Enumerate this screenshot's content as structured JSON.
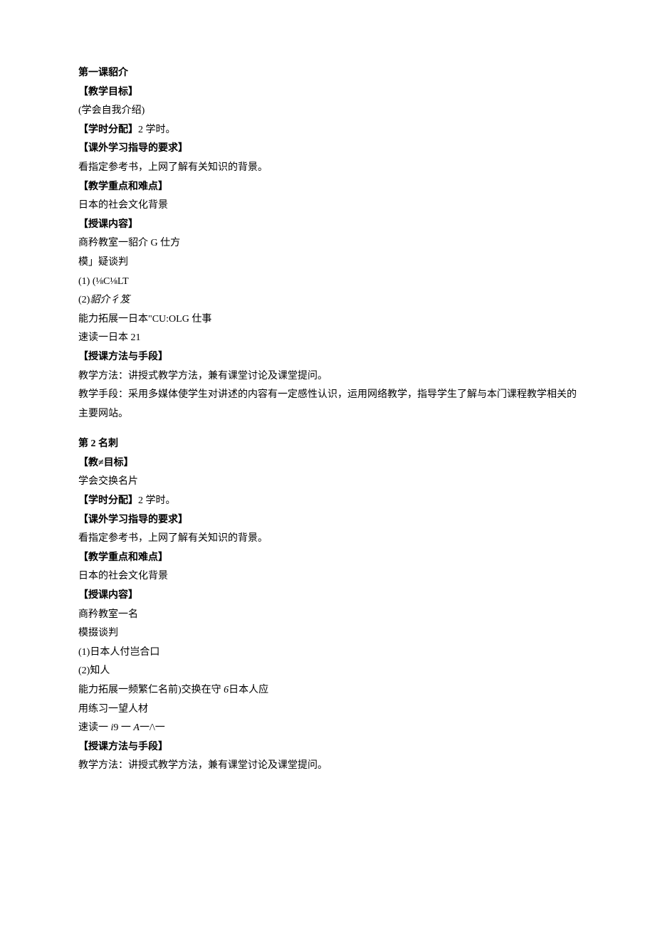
{
  "lesson1": {
    "title": "第一课貂介",
    "goal_label": "【教学目标】",
    "goal_text": "(学会自我介绍)",
    "hours_label": "【学时分配】",
    "hours_text": "2 学时。",
    "extra_label": "【课外学习指导的要求】",
    "extra_text": "看指定参考书，上网了解有关知识的背景。",
    "focus_label": "【教学重点和难点】",
    "focus_text": "日本的社会文化背景",
    "content_label": "【授课内容】",
    "content_1": "商矜教室一貂介 G 仕方",
    "content_2": "模」疑谈判",
    "content_3": "(1)   (⅛C⅛LT",
    "content_4_a": "(2)",
    "content_4_b": "貂介彳笈",
    "content_5": "能力拓展一日本\"CU:OLG 仕事",
    "content_6": "速读一日本 21",
    "method_label": "【授课方法与手段】",
    "method_1": "教学方法：讲授式教学方法，兼有课堂讨论及课堂提问。",
    "method_2": "教学手段：采用多媒体使学生对讲述的内容有一定感性认识，运用网络教学，指导学生了解与本门课程教学相关的主要网站。"
  },
  "lesson2": {
    "title": "第 2 名刺",
    "goal_label": "【教≠目标】",
    "goal_text": "学会交换名片",
    "hours_label": "【学时分配】",
    "hours_text": "2 学时。",
    "extra_label": "【课外学习指导的要求】",
    "extra_text": "看指定参考书，上网了解有关知识的背景。",
    "focus_label": "【教学重点和难点】",
    "focus_text": "日本的社会文化背景",
    "content_label": "【授课内容】",
    "content_1": "商矜教室一名",
    "content_2": "模掇谈判",
    "content_3": "(1)日本人付岂合口",
    "content_4": "(2)知人",
    "content_5_a": "能力拓展一频繁仁名前)交换在守 ",
    "content_5_b": "6",
    "content_5_c": "日本人应",
    "content_6": "用练习一望人材",
    "content_7_a": "速读一 ",
    "content_7_b": "i",
    "content_7_c": "9 一 ",
    "content_7_d": "A",
    "content_7_e": "一/\\一",
    "method_label": "【授课方法与手段】",
    "method_1": "教学方法：讲授式教学方法，兼有课堂讨论及课堂提问。"
  }
}
